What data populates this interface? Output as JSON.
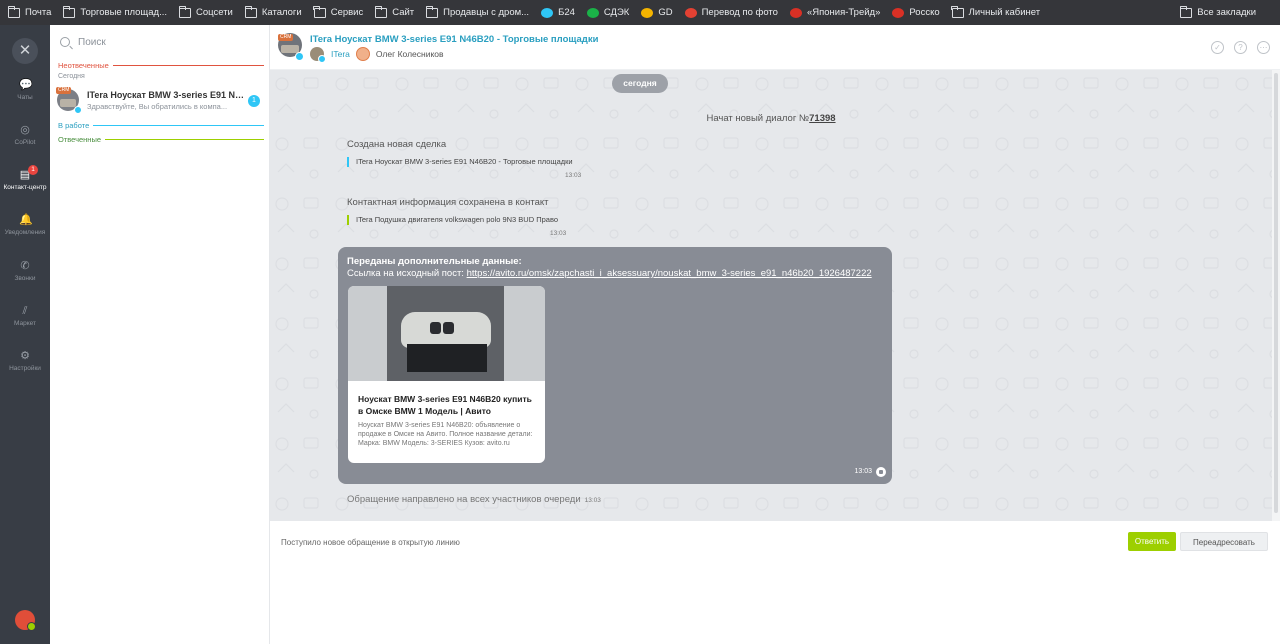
{
  "bookmarks": {
    "items": [
      {
        "label": "Почта",
        "icon": "folder-icon"
      },
      {
        "label": "Торговые площад...",
        "icon": "folder-icon"
      },
      {
        "label": "Соцсети",
        "icon": "folder-icon"
      },
      {
        "label": "Каталоги",
        "icon": "folder-icon"
      },
      {
        "label": "Сервис",
        "icon": "folder-icon"
      },
      {
        "label": "Сайт",
        "icon": "folder-icon"
      },
      {
        "label": "Продавцы с дром...",
        "icon": "folder-icon"
      },
      {
        "label": "Б24",
        "icon": "b24-icon",
        "color": "#2fc6f6"
      },
      {
        "label": "СДЭК",
        "icon": "cdek-icon",
        "color": "#1ab248"
      },
      {
        "label": "GD",
        "icon": "google-drive-icon",
        "color": "#f4b400"
      },
      {
        "label": "Перевод по фото",
        "icon": "translate-icon",
        "color": "#e34133"
      },
      {
        "label": "«Япония-Трейд»",
        "icon": "japan-trade-icon",
        "color": "#d93025"
      },
      {
        "label": "Росско",
        "icon": "rossko-icon",
        "color": "#d93025"
      },
      {
        "label": "Личный кабинет",
        "icon": "folder-icon"
      }
    ],
    "all_label": "Все закладки"
  },
  "rail": {
    "items": [
      {
        "label": "Чаты",
        "icon": "chat-icon"
      },
      {
        "label": "CoPilot",
        "icon": "copilot-icon"
      },
      {
        "label": "Контакт-центр",
        "icon": "contact-center-icon",
        "badge": "1"
      },
      {
        "label": "Уведомления",
        "icon": "bell-icon"
      },
      {
        "label": "Звонки",
        "icon": "phone-icon"
      },
      {
        "label": "Маркет",
        "icon": "market-icon"
      },
      {
        "label": "Настройки",
        "icon": "gear-icon"
      }
    ]
  },
  "list": {
    "search_placeholder": "Поиск",
    "sec_unanswered": "Неотвеченные",
    "today": "Сегодня",
    "sec_inwork": "В работе",
    "sec_answered": "Отвеченные",
    "conv": {
      "crm": "CRM",
      "title": "ITera Ноускат BMW 3-series E91 N4...",
      "preview": "Здравствуйте, Вы обратились в компа...",
      "count": "1"
    }
  },
  "chat": {
    "crm": "CRM",
    "title": "ITera Ноускат BMW 3-series E91 N46B20 - Торговые площадки",
    "member1": "ITera",
    "member2": "Олег Колесников",
    "date_pill": "сегодня",
    "dialog_start": "Начат новый диалог №",
    "dialog_no": "71398",
    "deal_created": "Создана новая сделка",
    "deal_quote": "ITera Ноускат BMW 3-series E91 N46B20 - Торговые площадки",
    "deal_time": "13:03",
    "contact_saved": "Контактная информация сохранена в контакт",
    "contact_quote": "ITera Подушка двигателя volkswagen polo 9N3 BUD Право",
    "contact_time": "13:03",
    "bubble_title": "Переданы дополнительные данные:",
    "bubble_link_prefix": "Ссылка на исходный пост: ",
    "bubble_link": "https://avito.ru/omsk/zapchasti_i_aksessuary/nouskat_bmw_3-series_e91_n46b20_1926487222",
    "card_title": "Ноускат BMW 3-series E91 N46B20 купить в Омске BMW 1 Модель | Авито",
    "card_desc": "Ноускат BMW 3-series E91 N46B20: объявление о продаже в Омске на Авито. Полное название детали: Марка: BMW Модель: 3-SERIES Кузов: avito.ru",
    "bubble_time": "13:03",
    "routed": "Обращение направлено на всех участников очереди",
    "routed_time": "13:03"
  },
  "footer": {
    "status_text": "Поступило новое обращение в открытую линию",
    "reply_label": "Ответить",
    "forward_label": "Переадресовать"
  }
}
